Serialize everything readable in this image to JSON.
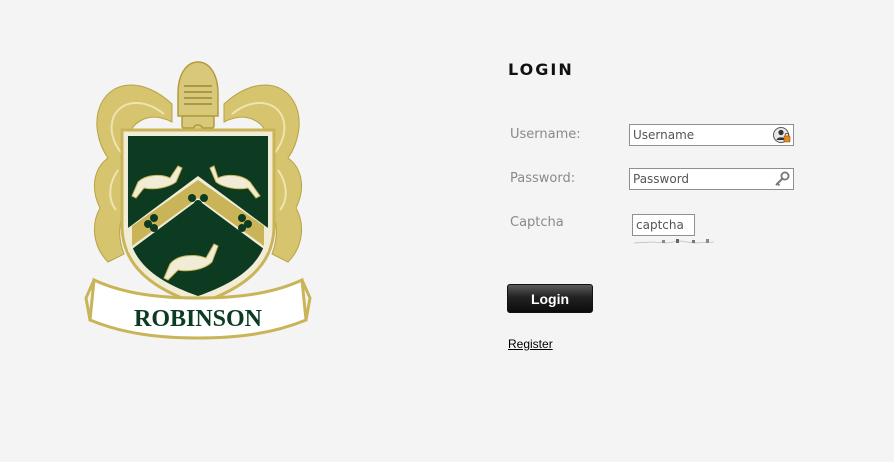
{
  "logo": {
    "text": "ROBINSON",
    "colors": {
      "green": "#0d3b22",
      "gold": "#c9b458",
      "gold_light": "#d8c87a",
      "cream": "#f1ecd6",
      "white": "#ffffff"
    }
  },
  "login": {
    "title": "LOGIN",
    "username": {
      "label": "Username:",
      "placeholder": "Username",
      "icon": "user-lock-icon"
    },
    "password": {
      "label": "Password:",
      "placeholder": "Password",
      "icon": "key-icon"
    },
    "captcha": {
      "label": "Captcha",
      "placeholder": "captcha"
    },
    "button_label": "Login",
    "register_label": "Register"
  }
}
